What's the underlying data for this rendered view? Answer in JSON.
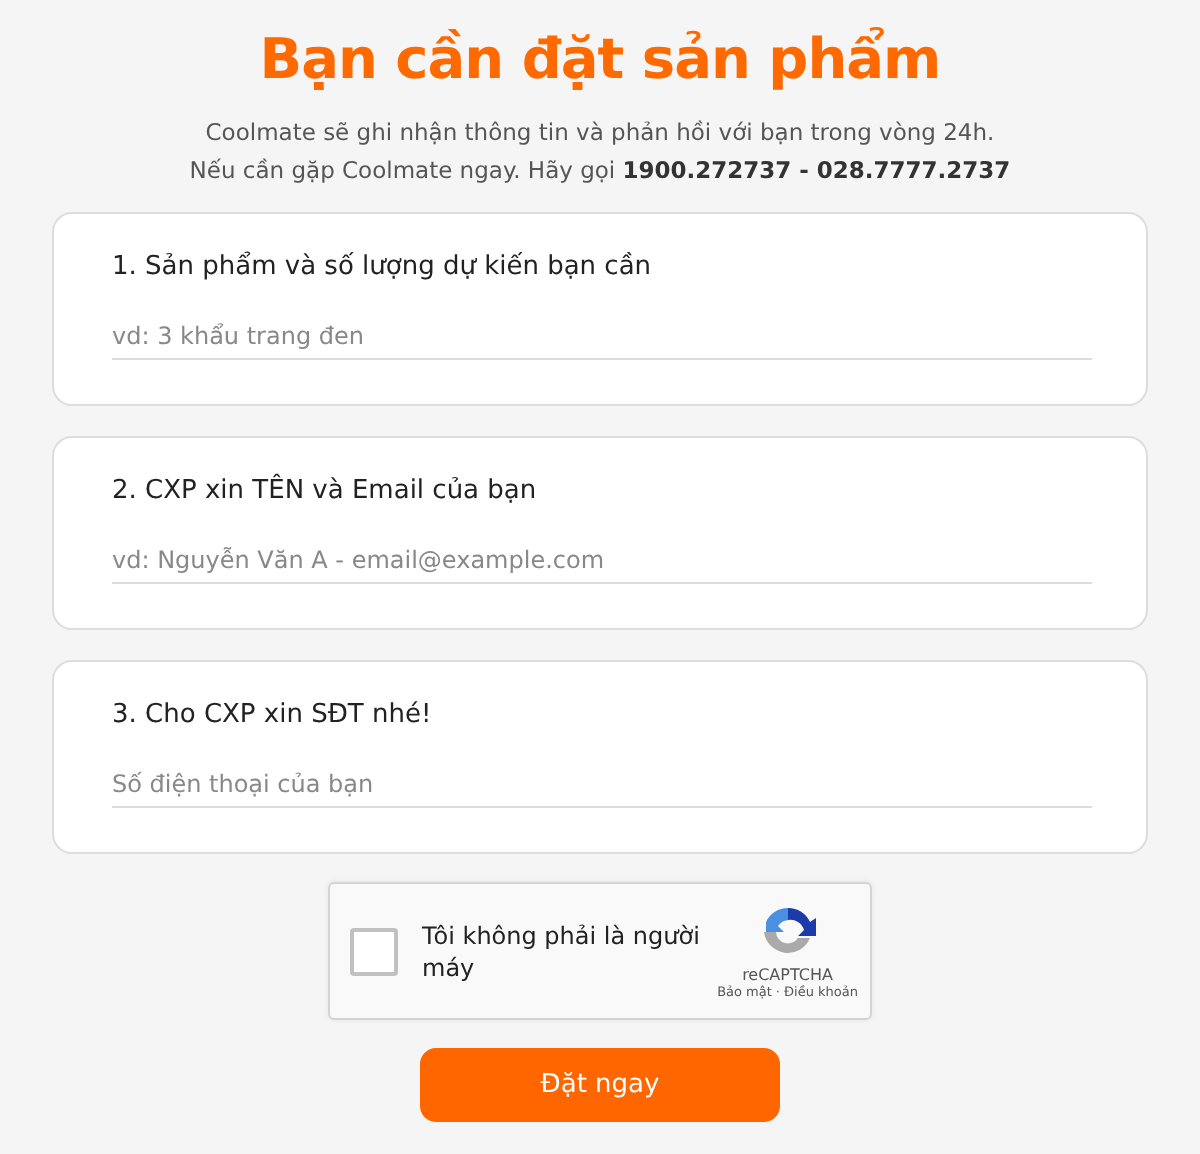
{
  "title": "Bạn cần đặt sản phẩm",
  "intro": [
    "Coolmate sẽ ghi nhận thông tin và phản hồi với bạn trong vòng 24h.",
    "Nếu cần gặp Coolmate ngay. Hãy gọi **1900.272737 - 028.7777.2737**"
  ],
  "questions": [
    {
      "label": "1. Sản phẩm và số lượng dự kiến bạn cần",
      "placeholder": "vd: 3 khẩu trang đen"
    },
    {
      "label": "2. CXP xin TÊN và Email của bạn",
      "placeholder": "vd: Nguyễn Văn A - email@example.com"
    },
    {
      "label": "3. Cho CXP xin SĐT nhé!",
      "placeholder": "Số điện thoại của bạn"
    }
  ],
  "captcha": {
    "label": "Tôi không phải là người máy",
    "checked": false,
    "brand": "reCAPTCHA",
    "links": [
      "Bảo mật",
      "Điều khoản"
    ],
    "separator": "·"
  },
  "submit": "Đặt ngay"
}
